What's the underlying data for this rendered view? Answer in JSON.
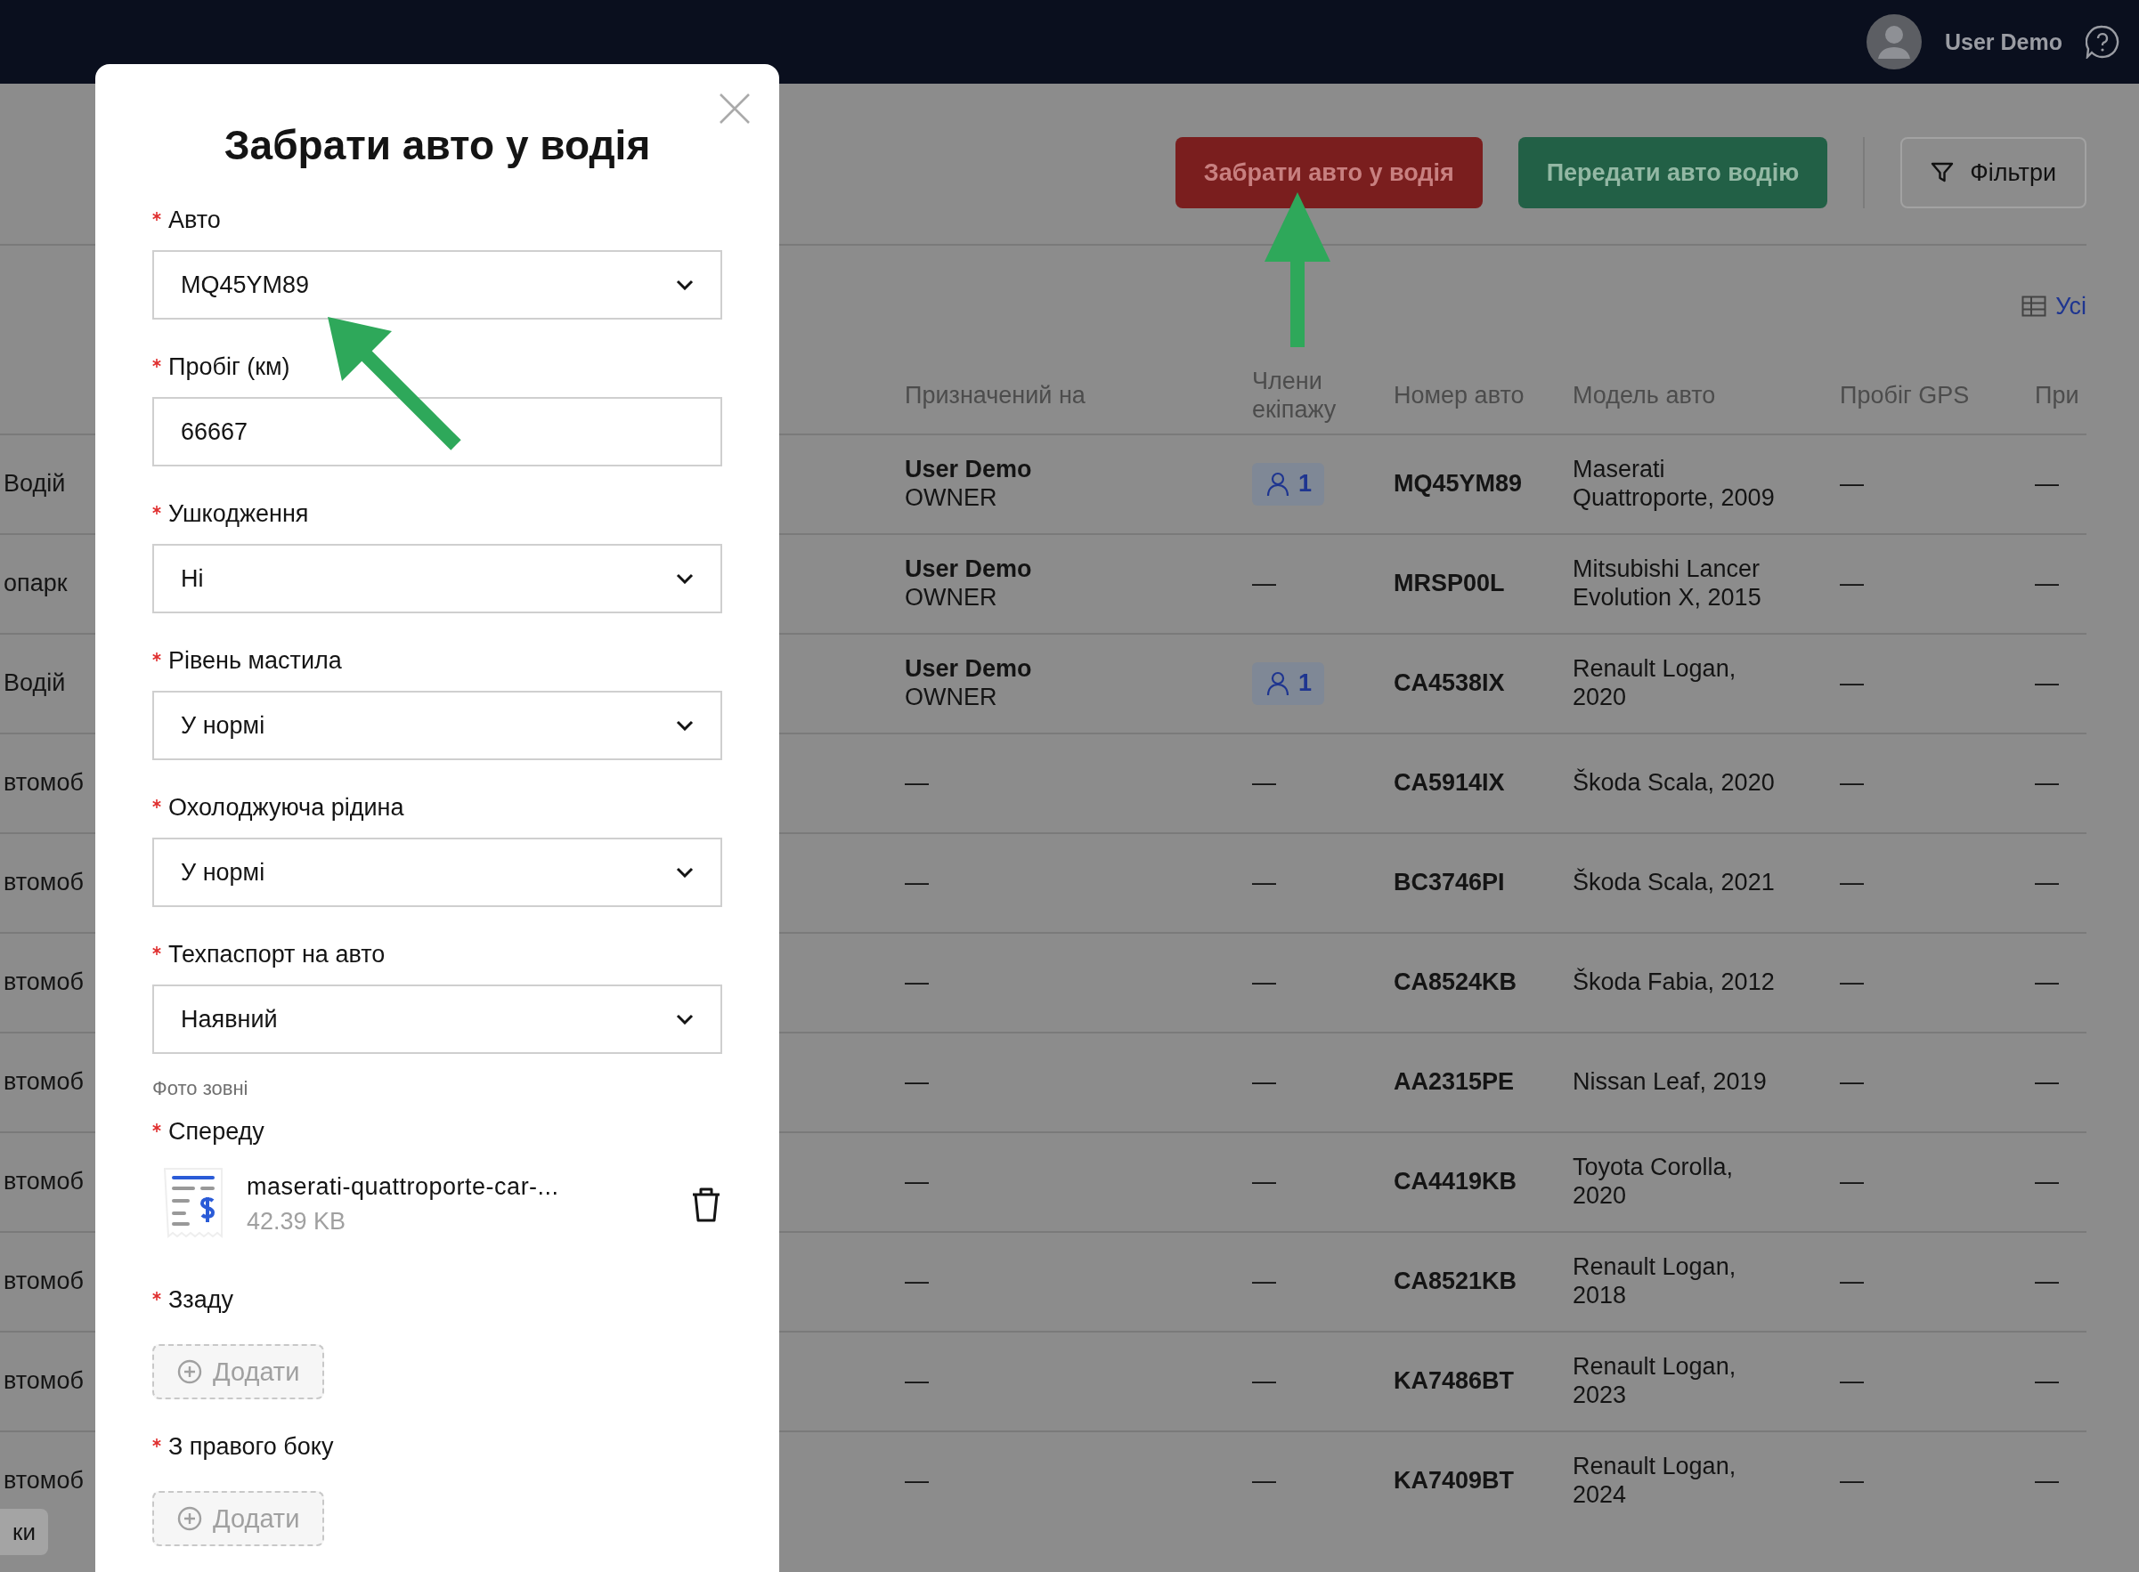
{
  "top_bar": {
    "user_name": "User Demo"
  },
  "toolbar": {
    "buttons": [
      {
        "label": "Забрати авто у водія",
        "kind": "danger"
      },
      {
        "label": "Передати авто водію",
        "kind": "success"
      },
      {
        "label": "Фільтри",
        "kind": "filter"
      }
    ]
  },
  "columns_link": "Усі",
  "table": {
    "columns": [
      "Призначений на",
      "Члени екіпажу",
      "Номер авто",
      "Модель авто",
      "Пробіг GPS",
      "При"
    ],
    "rows": [
      {
        "column_1": "Водій",
        "assignee": "User Demo",
        "role": "OWNER",
        "crew": "1",
        "plate": "MQ45YM89",
        "model": "Maserati Quattroporte, 2009",
        "gps": "—",
        "column_8": "—"
      },
      {
        "column_1": "опарк",
        "assignee": "User Demo",
        "role": "OWNER",
        "crew": "—",
        "plate": "MRSP00L",
        "model": "Mitsubishi Lancer Evolution X, 2015",
        "gps": "—",
        "column_8": "—"
      },
      {
        "column_1": "Водій",
        "assignee": "User Demo",
        "role": "OWNER",
        "crew": "1",
        "plate": "CA4538IX",
        "model": "Renault Logan, 2020",
        "gps": "—",
        "column_8": "—"
      },
      {
        "column_1": "втомоб",
        "assignee": "—",
        "crew": "—",
        "plate": "CA5914IX",
        "model": "Škoda Scala, 2020",
        "gps": "—",
        "column_8": "—"
      },
      {
        "column_1": "втомоб",
        "assignee": "—",
        "crew": "—",
        "plate": "BC3746PI",
        "model": "Škoda Scala, 2021",
        "gps": "—",
        "column_8": "—"
      },
      {
        "column_1": "втомоб",
        "assignee": "—",
        "crew": "—",
        "plate": "CA8524KB",
        "model": "Škoda Fabia, 2012",
        "gps": "—",
        "column_8": "—"
      },
      {
        "column_1": "втомоб",
        "assignee": "—",
        "crew": "—",
        "plate": "AA2315PE",
        "model": "Nissan Leaf, 2019",
        "gps": "—",
        "column_8": "—"
      },
      {
        "column_1": "втомоб",
        "assignee": "—",
        "crew": "—",
        "plate": "CA4419KB",
        "model": "Toyota Corolla, 2020",
        "gps": "—",
        "column_8": "—"
      },
      {
        "column_1": "втомоб",
        "assignee": "—",
        "crew": "—",
        "plate": "CA8521KB",
        "model": "Renault Logan, 2018",
        "gps": "—",
        "column_8": "—"
      },
      {
        "column_1": "втомоб",
        "assignee": "—",
        "crew": "—",
        "plate": "KA7486BT",
        "model": "Renault Logan, 2023",
        "gps": "—",
        "column_8": "—"
      },
      {
        "column_1": "втомоб",
        "assignee": "—",
        "crew": "—",
        "plate": "KA7409BT",
        "model": "Renault Logan, 2024",
        "gps": "—",
        "column_8": "—"
      }
    ]
  },
  "side_button": "ки",
  "modal": {
    "title": "Забрати авто у водія",
    "fields": [
      {
        "label": "Авто",
        "required": true,
        "kind": "select",
        "value": "MQ45YM89"
      },
      {
        "label": "Пробіг (км)",
        "required": true,
        "kind": "input",
        "value": "66667"
      },
      {
        "label": "Ушкодження",
        "required": true,
        "kind": "select",
        "value": "Ні"
      },
      {
        "label": "Рівень мастила",
        "required": true,
        "kind": "select",
        "value": "У нормі"
      },
      {
        "label": "Охолоджуюча рідина",
        "required": true,
        "kind": "select",
        "value": "У нормі"
      },
      {
        "label": "Техпаспорт на авто",
        "required": true,
        "kind": "select",
        "value": "Наявний"
      }
    ],
    "section": "Фото зовні",
    "photos": [
      {
        "label": "Спереду",
        "required": true,
        "kind": "file",
        "file_name": "maserati-quattroporte-car-...",
        "file_size": "42.39 KB"
      },
      {
        "label": "Ззаду",
        "required": true,
        "kind": "empty",
        "add_label": "Додати"
      },
      {
        "label": "З правого боку",
        "required": true,
        "kind": "empty",
        "add_label": "Додати"
      }
    ]
  }
}
